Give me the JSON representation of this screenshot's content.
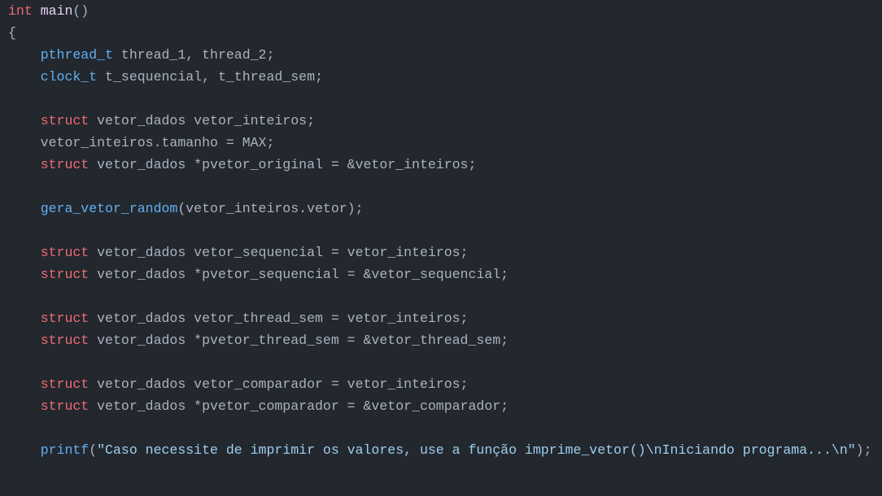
{
  "code_lines": [
    [
      {
        "t": "kw",
        "v": "int"
      },
      {
        "t": "plain",
        "v": " "
      },
      {
        "t": "fn-main",
        "v": "main"
      },
      {
        "t": "plain",
        "v": "()"
      }
    ],
    [
      {
        "t": "plain",
        "v": "{"
      }
    ],
    [
      {
        "t": "plain",
        "v": "    "
      },
      {
        "t": "type",
        "v": "pthread_t"
      },
      {
        "t": "plain",
        "v": " thread_1, thread_2;"
      }
    ],
    [
      {
        "t": "plain",
        "v": "    "
      },
      {
        "t": "type",
        "v": "clock_t"
      },
      {
        "t": "plain",
        "v": " t_sequencial, t_thread_sem;"
      }
    ],
    [],
    [
      {
        "t": "plain",
        "v": "    "
      },
      {
        "t": "kw",
        "v": "struct"
      },
      {
        "t": "plain",
        "v": " vetor_dados vetor_inteiros;"
      }
    ],
    [
      {
        "t": "plain",
        "v": "    vetor_inteiros.tamanho = MAX;"
      }
    ],
    [
      {
        "t": "plain",
        "v": "    "
      },
      {
        "t": "kw",
        "v": "struct"
      },
      {
        "t": "plain",
        "v": " vetor_dados *pvetor_original = &vetor_inteiros;"
      }
    ],
    [],
    [
      {
        "t": "plain",
        "v": "    "
      },
      {
        "t": "fn",
        "v": "gera_vetor_random"
      },
      {
        "t": "plain",
        "v": "(vetor_inteiros.vetor);"
      }
    ],
    [],
    [
      {
        "t": "plain",
        "v": "    "
      },
      {
        "t": "kw",
        "v": "struct"
      },
      {
        "t": "plain",
        "v": " vetor_dados vetor_sequencial = vetor_inteiros;"
      }
    ],
    [
      {
        "t": "plain",
        "v": "    "
      },
      {
        "t": "kw",
        "v": "struct"
      },
      {
        "t": "plain",
        "v": " vetor_dados *pvetor_sequencial = &vetor_sequencial;"
      }
    ],
    [],
    [
      {
        "t": "plain",
        "v": "    "
      },
      {
        "t": "kw",
        "v": "struct"
      },
      {
        "t": "plain",
        "v": " vetor_dados vetor_thread_sem = vetor_inteiros;"
      }
    ],
    [
      {
        "t": "plain",
        "v": "    "
      },
      {
        "t": "kw",
        "v": "struct"
      },
      {
        "t": "plain",
        "v": " vetor_dados *pvetor_thread_sem = &vetor_thread_sem;"
      }
    ],
    [],
    [
      {
        "t": "plain",
        "v": "    "
      },
      {
        "t": "kw",
        "v": "struct"
      },
      {
        "t": "plain",
        "v": " vetor_dados vetor_comparador = vetor_inteiros;"
      }
    ],
    [
      {
        "t": "plain",
        "v": "    "
      },
      {
        "t": "kw",
        "v": "struct"
      },
      {
        "t": "plain",
        "v": " vetor_dados *pvetor_comparador = &vetor_comparador;"
      }
    ],
    [],
    [
      {
        "t": "plain",
        "v": "    "
      },
      {
        "t": "fn",
        "v": "printf"
      },
      {
        "t": "plain",
        "v": "("
      },
      {
        "t": "str",
        "v": "\"Caso necessite de imprimir os valores, use a função imprime_vetor()\\nIniciando programa...\\n\""
      },
      {
        "t": "plain",
        "v": ");"
      }
    ]
  ],
  "colors": {
    "background": "#23272e",
    "keyword": "#ef6b73",
    "type": "#61afef",
    "function": "#61afef",
    "main_function": "#e6d3f2",
    "string": "#9ccfee",
    "plain": "#abb2bf"
  }
}
